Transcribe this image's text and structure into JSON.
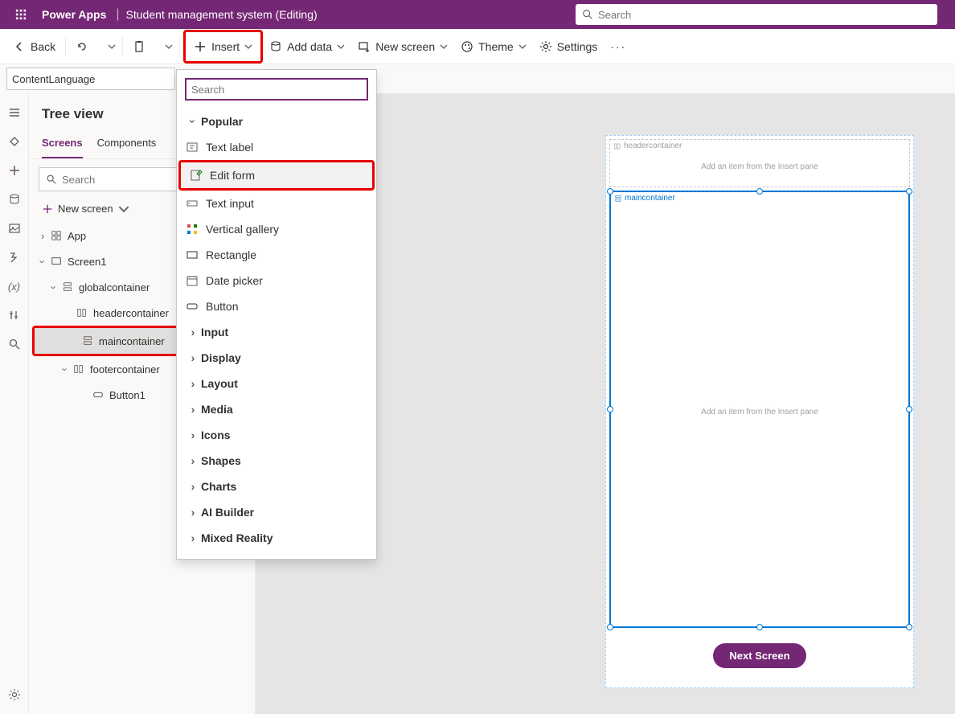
{
  "topbar": {
    "brand": "Power Apps",
    "separator": "|",
    "title": "Student management system (Editing)",
    "search_placeholder": "Search"
  },
  "cmdbar": {
    "back": "Back",
    "insert": "Insert",
    "add_data": "Add data",
    "new_screen": "New screen",
    "theme": "Theme",
    "settings": "Settings"
  },
  "formula": {
    "name": "ContentLanguage"
  },
  "tree": {
    "title": "Tree view",
    "tabs": {
      "screens": "Screens",
      "components": "Components"
    },
    "search_placeholder": "Search",
    "new_screen": "New screen",
    "nodes": {
      "app": "App",
      "screen1": "Screen1",
      "global": "globalcontainer",
      "header": "headercontainer",
      "main": "maincontainer",
      "footer": "footercontainer",
      "button1": "Button1"
    }
  },
  "insert": {
    "search_placeholder": "Search",
    "cat_popular": "Popular",
    "items": {
      "text_label": "Text label",
      "edit_form": "Edit form",
      "text_input": "Text input",
      "vertical_gallery": "Vertical gallery",
      "rectangle": "Rectangle",
      "date_picker": "Date picker",
      "button": "Button"
    },
    "cats": {
      "input": "Input",
      "display": "Display",
      "layout": "Layout",
      "media": "Media",
      "icons": "Icons",
      "shapes": "Shapes",
      "charts": "Charts",
      "ai_builder": "AI Builder",
      "mixed_reality": "Mixed Reality"
    }
  },
  "canvas": {
    "header_label": "headercontainer",
    "header_msg": "Add an item from the Insert pane",
    "main_label": "maincontainer",
    "main_msg": "Add an item from the Insert pane",
    "next_btn": "Next Screen"
  }
}
